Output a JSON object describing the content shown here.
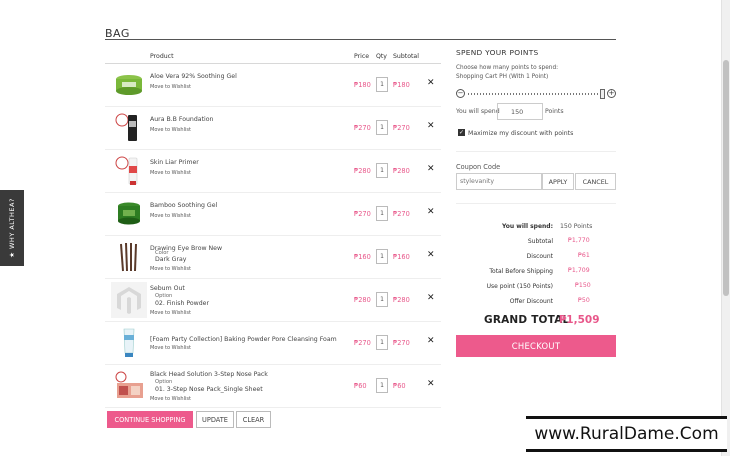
{
  "side_tab": {
    "label": "★ WHY ALTHEA?"
  },
  "bag": {
    "title": "BAG",
    "columns": {
      "product": "Product",
      "price": "Price",
      "qty": "Qty",
      "subtotal": "Subtotal"
    },
    "items": [
      {
        "name": "Aloe Vera 92% Soothing Gel",
        "wishlist": "Move to Wishlist",
        "price": "₱180",
        "qty": "1",
        "subtotal": "₱180",
        "icon": "aloe-jar-icon"
      },
      {
        "name": "Aura B.B Foundation",
        "wishlist": "Move to Wishlist",
        "price": "₱270",
        "qty": "1",
        "subtotal": "₱270",
        "icon": "bb-tube-icon"
      },
      {
        "name": "Skin Liar Primer",
        "wishlist": "Move to Wishlist",
        "price": "₱280",
        "qty": "1",
        "subtotal": "₱280",
        "icon": "primer-tube-icon"
      },
      {
        "name": "Bamboo Soothing Gel",
        "wishlist": "Move to Wishlist",
        "price": "₱270",
        "qty": "1",
        "subtotal": "₱270",
        "icon": "bamboo-jar-icon"
      },
      {
        "name": "Drawing Eye Brow New",
        "option_label": "Color",
        "option_value": "Dark Gray",
        "wishlist": "Move to Wishlist",
        "price": "₱160",
        "qty": "1",
        "subtotal": "₱160",
        "icon": "brow-pencil-icon"
      },
      {
        "name": "Sebum Out",
        "option_label": "Option",
        "option_value": "02. Finish Powder",
        "wishlist": "Move to Wishlist",
        "price": "₱280",
        "qty": "1",
        "subtotal": "₱280",
        "icon": "placeholder-logo-icon"
      },
      {
        "name": "[Foam Party Collection] Baking Powder Pore Cleansing Foam",
        "wishlist": "Move to Wishlist",
        "price": "₱270",
        "qty": "1",
        "subtotal": "₱270",
        "icon": "foam-tube-icon"
      },
      {
        "name": "Black Head Solution 3-Step Nose Pack",
        "option_label": "Option",
        "option_value": "01. 3-Step Nose Pack_Single Sheet",
        "wishlist": "Move to Wishlist",
        "price": "₱60",
        "qty": "1",
        "subtotal": "₱60",
        "icon": "nose-pack-icon"
      }
    ],
    "buttons": {
      "continue": "CONTINUE SHOPPING",
      "update": "UPDATE",
      "clear": "CLEAR"
    }
  },
  "points": {
    "title": "SPEND YOUR POINTS",
    "desc_line1": "Choose how many points to spend:",
    "desc_line2": "Shopping Cart PH (With 1 Point)",
    "slider_value": 150,
    "spend_label": "You will spend",
    "spend_value": "150",
    "spend_unit": "Points",
    "maximize_label": "Maximize my discount with points",
    "maximize_checked": true
  },
  "coupon": {
    "label": "Coupon Code",
    "value": "stylevanity",
    "apply": "APPLY",
    "cancel": "CANCEL"
  },
  "summary": {
    "rows": [
      {
        "label": "You will spend:",
        "value": "150 Points",
        "bold": true
      },
      {
        "label": "Subtotal",
        "value": "₱1,770"
      },
      {
        "label": "Discount",
        "value": "₱61"
      },
      {
        "label": "Total Before Shipping",
        "value": "₱1,709"
      },
      {
        "label": "Use point (150 Points)",
        "value": "₱150"
      },
      {
        "label": "Offer Discount",
        "value": "₱50"
      }
    ],
    "grand_total_label": "GRAND TOTAL",
    "grand_total_value": "₱1,509",
    "checkout": "CHECKOUT"
  },
  "watermark": "www.RuralDame.Com",
  "colors": {
    "accent": "#ed5a8c",
    "price": "#e8578a",
    "side_tab": "#3a3a3a"
  }
}
